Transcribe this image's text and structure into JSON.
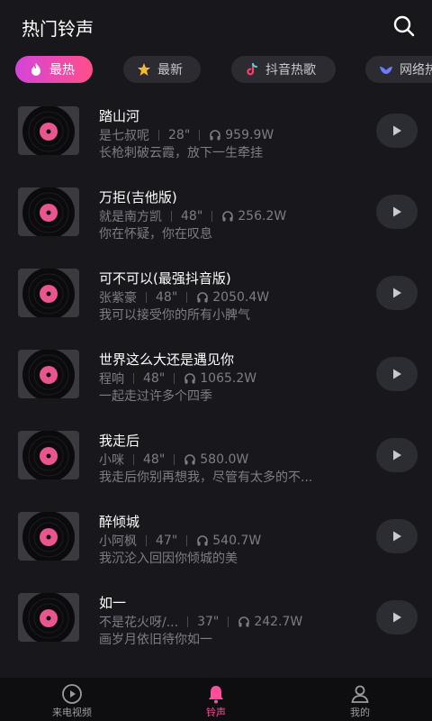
{
  "header": {
    "title": "热门铃声",
    "search_icon": "search-icon"
  },
  "tabs": [
    {
      "label": "最热",
      "icon": "flame-icon",
      "active": true
    },
    {
      "label": "最新",
      "icon": "star-icon",
      "active": false
    },
    {
      "label": "抖音热歌",
      "icon": "tiktok-icon",
      "active": false
    },
    {
      "label": "网络热",
      "icon": "bird-icon",
      "active": false
    }
  ],
  "songs": [
    {
      "title": "踏山河",
      "artist": "是七叔呢",
      "duration": "28\"",
      "plays": "959.9W",
      "lyric": "长枪刺破云霞，放下一生牵挂"
    },
    {
      "title": "万拒(吉他版)",
      "artist": "就是南方凯",
      "duration": "48\"",
      "plays": "256.2W",
      "lyric": "你在怀疑，你在叹息"
    },
    {
      "title": "可不可以(最强抖音版)",
      "artist": "张紫豪",
      "duration": "48\"",
      "plays": "2050.4W",
      "lyric": "我可以接受你的所有小脾气"
    },
    {
      "title": "世界这么大还是遇见你",
      "artist": "程响",
      "duration": "48\"",
      "plays": "1065.2W",
      "lyric": "一起走过许多个四季"
    },
    {
      "title": "我走后",
      "artist": "小咪",
      "duration": "48\"",
      "plays": "580.0W",
      "lyric": "我走后你别再想我，尽管有太多的不..."
    },
    {
      "title": "醉倾城",
      "artist": "小阿枫",
      "duration": "47\"",
      "plays": "540.7W",
      "lyric": "我沉沦入回因你倾城的美"
    },
    {
      "title": "如一",
      "artist": "不是花火呀/...",
      "duration": "37\"",
      "plays": "242.7W",
      "lyric": "画岁月依旧待你如一"
    }
  ],
  "bottom_nav": [
    {
      "label": "来电视频",
      "icon": "video-icon",
      "active": false
    },
    {
      "label": "铃声",
      "icon": "bell-icon",
      "active": true
    },
    {
      "label": "我的",
      "icon": "user-icon",
      "active": false
    }
  ],
  "colors": {
    "accent": "#ff4f9a",
    "gradient_start": "#d544d9",
    "gradient_end": "#ff4f8a",
    "background": "#17171c",
    "disc_center": "#e8558f"
  }
}
